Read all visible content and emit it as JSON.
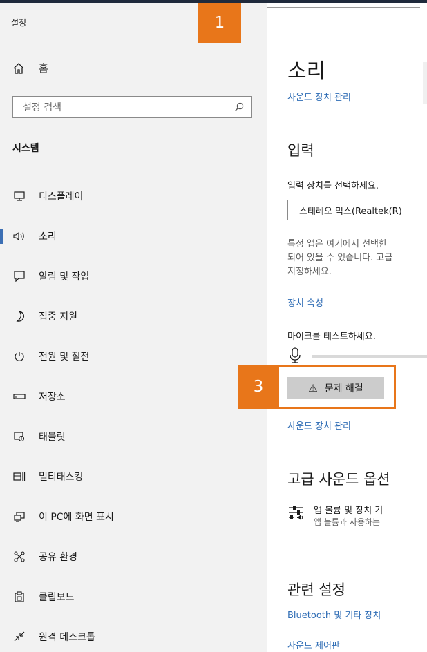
{
  "window": {
    "app_title": "설정"
  },
  "callouts": {
    "one": "1",
    "three": "3"
  },
  "sidebar": {
    "home_label": "홈",
    "search_placeholder": "설정 검색",
    "section_header": "시스템",
    "items": [
      {
        "label": "디스플레이",
        "icon": "display-icon"
      },
      {
        "label": "소리",
        "icon": "speaker-icon",
        "active": true
      },
      {
        "label": "알림 및 작업",
        "icon": "notification-icon"
      },
      {
        "label": "집중 지원",
        "icon": "moon-icon"
      },
      {
        "label": "전원 및 절전",
        "icon": "power-icon"
      },
      {
        "label": "저장소",
        "icon": "storage-icon"
      },
      {
        "label": "태블릿",
        "icon": "tablet-icon"
      },
      {
        "label": "멀티태스킹",
        "icon": "multitasking-icon"
      },
      {
        "label": "이 PC에 화면 표시",
        "icon": "project-icon"
      },
      {
        "label": "공유 환경",
        "icon": "share-icon"
      },
      {
        "label": "클립보드",
        "icon": "clipboard-icon"
      },
      {
        "label": "원격 데스크톱",
        "icon": "remote-desktop-icon"
      }
    ]
  },
  "main": {
    "title": "소리",
    "manage_devices_link": "사운드 장치 관리",
    "input_heading": "입력",
    "choose_input_label": "입력 장치를 선택하세요.",
    "input_device_value": "스테레오 믹스(Realtek(R)",
    "input_desc_lines": [
      "특정 앱은 여기에서 선택한",
      "되어 있을 수 있습니다. 고급",
      "지정하세요."
    ],
    "device_properties_link": "장치 속성",
    "test_mic_label": "마이크를 테스트하세요.",
    "mic_level": 0,
    "troubleshoot_label": "문제 해결",
    "manage_devices_link_2": "사운드 장치 관리",
    "advanced_heading": "고급 사운드 옵션",
    "app_volume_title": "앱 볼륨 및 장치 기",
    "app_volume_desc": "앱 볼륨과 사용하는",
    "related_heading": "관련 설정",
    "bluetooth_link": "Bluetooth 및 기타 장치",
    "sound_control_link": "사운드 제어판"
  },
  "colors": {
    "accent": "#2f6db5",
    "callout": "#e8761a",
    "sidebar_bg": "#f2f2f2",
    "active_bar": "#3c6fb4"
  }
}
